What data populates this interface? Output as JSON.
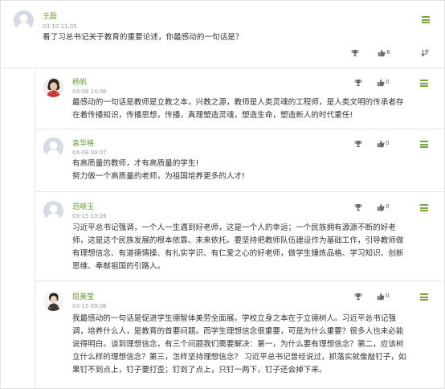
{
  "post": {
    "author": "王磊",
    "time": "03-10 11:05",
    "text": "看了习总书记关于教育的重要论述，你最感动的一句话是？",
    "likes": "8"
  },
  "replies": [
    {
      "author": "杨帆",
      "time": "04-08 14:06",
      "lines": [
        "最感动的一句话是教师是立教之本，兴教之源，教师是人类灵魂的工程师，是人类文明的传承者存",
        "在着传播知识，传播思想，传播，真理塑造灵魂，塑造生命，塑造新人的时代重任!"
      ],
      "likes": "0"
    },
    {
      "author": "袁华格",
      "time": "04-08 00:07",
      "lines": [
        "有高质量的教师，才有高质量的学生!",
        "努力做一个高质量的老师，为祖国培养更多的人才!"
      ],
      "likes": "0"
    },
    {
      "author": "范晓玉",
      "time": "03-15 13:26",
      "lines": [
        "习近平总书记强调，一个人一生遇到好老师，这是一个人的幸运；一个民族拥有源源不断的好老",
        "师，这是这个民族发展的根本依靠、未来依托。要坚持把教师队伍建设作为基础工作，引导教师做",
        "有理想信念、有道德情操、有扎实学识、有仁爱之心的好老师，做学生锤炼品格、学习知识、创新",
        "思维、奉献祖国的引路人。"
      ],
      "likes": "0"
    },
    {
      "author": "屈美莹",
      "time": "03-15 09:06",
      "lines": [
        "我最感动的一句话是促进学生德智体美劳全面展。学校立身之本在于立德树人。习近平总书记强",
        "调，培养什么人，是教育的首要问题。而学生理想信念很重要，可是为什么重要？很多人也未必能",
        "说得明白。谈到理想信念，有三个问题我们需要解决：第一，为什么要有理想信念？第二，应该树",
        "立什么样的理想信念？第三，怎样坚持理想信念？ 习近平总书记曾经说过，抓落实就像敲钉子，如",
        "果钉不到点上，钉子要打歪；钉到了点上，只钉一两下，钉子还会掉下来。"
      ],
      "likes": "0"
    }
  ],
  "icons": {
    "menu": "hamburger-menu-icon",
    "trophy": "trophy-icon",
    "like": "thumbs-up-icon",
    "reply": "reply-icon"
  },
  "colors": {
    "accent": "#78a83e",
    "name": "#6a9a35",
    "meta": "#999999",
    "border": "#e6e6e6"
  }
}
